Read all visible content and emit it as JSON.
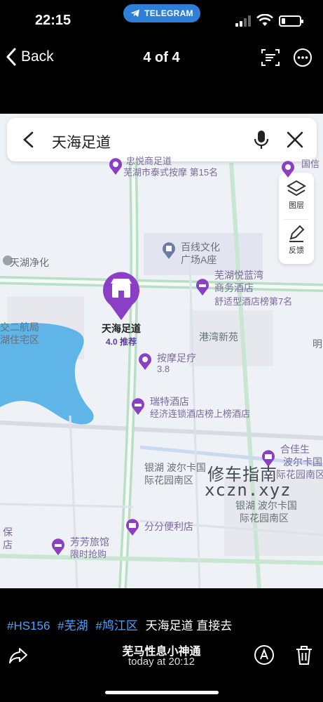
{
  "status_bar": {
    "time": "22:15",
    "app_badge": "TELEGRAM",
    "battery_level": 0.2
  },
  "nav": {
    "back_label": "Back",
    "counter": "4 of 4"
  },
  "map": {
    "search_query": "天海足道",
    "tools": {
      "layers_label": "图层",
      "feedback_label": "反馈"
    },
    "labels": {
      "l1": "芜湖市泰式按摩 第15名",
      "l2": "国信",
      "l3": "天湖净化",
      "l4": "百线文化",
      "l5": "广场A座",
      "l6": "芜湖悦蓝湾",
      "l7": "商务酒店",
      "l8": "舒适型酒店榜第7名",
      "l9": "交二航局",
      "l10": "湖住宅区",
      "l11": "港湾新苑",
      "l12": "明",
      "l13": "按摩足疗",
      "l14": "3.8",
      "l15": "瑞特酒店",
      "l16": "经济连锁酒店榜上榜酒店",
      "l17": "合佳生",
      "l18": "波尔卡国",
      "l19": "际花园南区",
      "l20": "银湖 波尔卡国",
      "l21": "际花园南区",
      "l22": "银湖 波尔卡国",
      "l23": "际花园南区",
      "l24": "分分便利店",
      "l25": "芳芳旅馆",
      "l26": "限时抢购",
      "l27": "保",
      "l28": "店",
      "l29": "忠悦商足道"
    },
    "main_poi": {
      "name": "天海足道",
      "rating": "4.0 推荐"
    },
    "watermark": {
      "cn": "修车指南",
      "en": "xczn.xyz"
    }
  },
  "caption": {
    "tags": [
      "#HS156",
      "#芜湖",
      "#鸠江区"
    ],
    "text": "天海足道 直接去"
  },
  "footer": {
    "sender": "芜马性息小神通",
    "date": "today at 20:12"
  },
  "colors": {
    "telegram_blue": "#2f7fd8",
    "hashtag_blue": "#4da3ff",
    "poi_purple": "#8a3fc4",
    "road_green": "#b9dfc6",
    "water_blue": "#5fb4e8"
  },
  "icons": [
    "telegram-icon",
    "signal-icon",
    "wifi-icon",
    "battery-icon",
    "back-chevron-icon",
    "scan-text-icon",
    "more-icon",
    "search-back-icon",
    "mic-icon",
    "clear-icon",
    "layers-icon",
    "feedback-pen-icon",
    "share-icon",
    "edit-icon",
    "trash-icon"
  ]
}
